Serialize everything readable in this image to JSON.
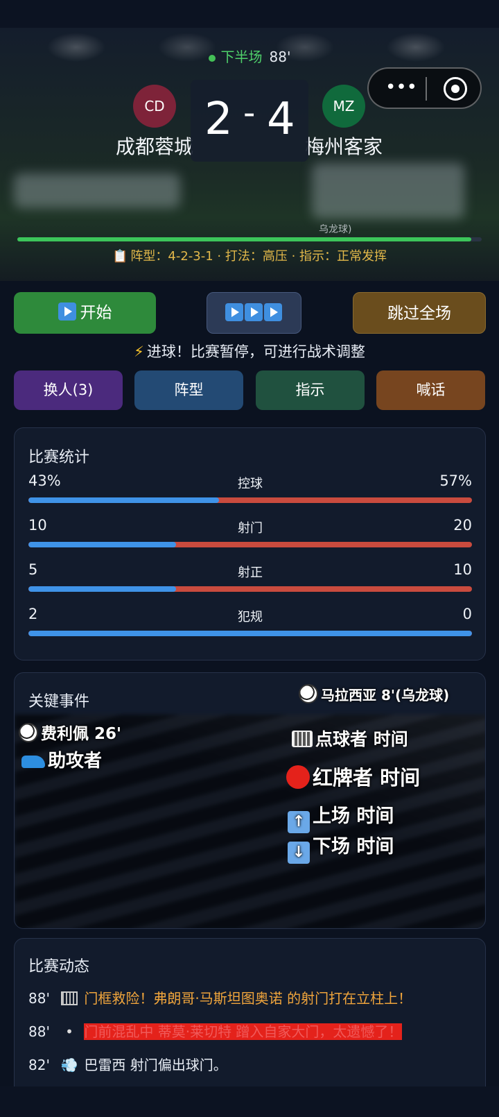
{
  "match": {
    "phase": "下半场",
    "minute": "88'",
    "home": {
      "abbr": "CD",
      "name": "成都蓉城",
      "score": "2",
      "color": "#7e2339"
    },
    "away": {
      "abbr": "MZ",
      "name": "梅州客家",
      "score": "4",
      "color": "#106a3c"
    },
    "score_sep": "-",
    "progress_percent": 97.7,
    "tactics": "阵型：4-2-3-1 · 打法：高压 · 指示：正常发挥",
    "hint_text": "乌龙球)"
  },
  "capsule": {
    "more_icon": "more-icon",
    "target_icon": "target-icon"
  },
  "controls": {
    "start_label": "开始",
    "speed_icons": "three-play-icons",
    "skip_label": "跳过全场",
    "notice": "进球！比赛暂停，可进行战术调整",
    "sub_label": "换人(3)",
    "formation_label": "阵型",
    "instructions_label": "指示",
    "shout_label": "喊话"
  },
  "stats": {
    "title": "比赛统计",
    "rows": [
      {
        "name": "控球",
        "home": "43%",
        "away": "57%",
        "home_value": 43,
        "away_value": 57
      },
      {
        "name": "射门",
        "home": "10",
        "away": "20",
        "home_value": 10,
        "away_value": 20
      },
      {
        "name": "射正",
        "home": "5",
        "away": "10",
        "home_value": 5,
        "away_value": 10
      },
      {
        "name": "犯规",
        "home": "2",
        "away": "0",
        "home_value": 2,
        "away_value": 0
      }
    ]
  },
  "events": {
    "title": "关键事件",
    "own_goal": "马拉西亚 8'(乌龙球)",
    "goal": "费利佩 26'",
    "assist": "助攻者",
    "penalty": "点球者 时间",
    "red_card": "红牌者 时间",
    "sub_in": "上场 时间",
    "sub_out": "下场 时间"
  },
  "feed": {
    "title": "比赛动态",
    "items": [
      {
        "time": "88'",
        "icon": "goal-frame-icon",
        "text": "门框救险！弗朗哥·马斯坦图奥诺 的射门打在立柱上！",
        "tone": "orange"
      },
      {
        "time": "88'",
        "icon": "dot-icon",
        "text": "门前混乱中 蒂莫·莱切特 蹭入自家大门，太遗憾了！",
        "tone": "red"
      },
      {
        "time": "82'",
        "icon": "wind-icon",
        "text": "巴雷西 射门偏出球门。",
        "tone": "white"
      }
    ]
  }
}
